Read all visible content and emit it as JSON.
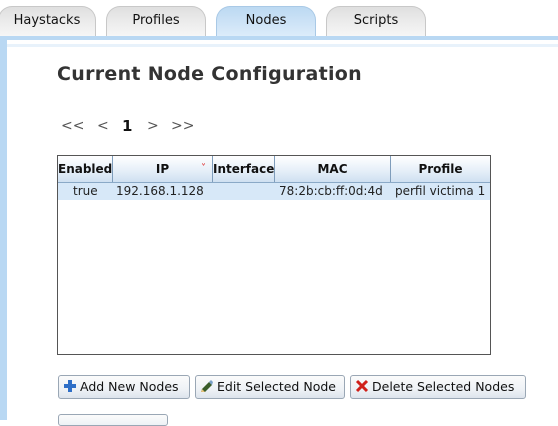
{
  "tabs": [
    {
      "label": "Haystacks",
      "active": false
    },
    {
      "label": "Profiles",
      "active": false
    },
    {
      "label": "Nodes",
      "active": true
    },
    {
      "label": "Scripts",
      "active": false
    }
  ],
  "page": {
    "title": "Current Node Configuration"
  },
  "pager": {
    "first": "<<",
    "prev": "<",
    "current": "1",
    "next": ">",
    "last": ">>"
  },
  "grid": {
    "columns": [
      "Enabled",
      "IP",
      "Interface",
      "MAC",
      "Profile"
    ],
    "sorted_column": "IP",
    "sort_direction": "descending",
    "rows": [
      {
        "enabled": "true",
        "ip": "192.168.1.128",
        "interface": "",
        "mac": "78:2b:cb:ff:0d:4d",
        "profile": "perfil victima 1"
      }
    ]
  },
  "buttons": {
    "add": "Add New Nodes",
    "edit": "Edit Selected Node",
    "delete": "Delete Selected Nodes"
  },
  "colors": {
    "tab_active": "#cfe4f7",
    "frame": "#b9d8f3",
    "selected_row": "#d7e8f8",
    "sort_icon": "#dd2222",
    "add_icon": "#2f6fc7",
    "delete_icon": "#d0201a"
  },
  "icons": {
    "add": "plus-icon",
    "edit": "pencil-icon",
    "delete": "x-icon",
    "sort": "sort-down-icon"
  }
}
